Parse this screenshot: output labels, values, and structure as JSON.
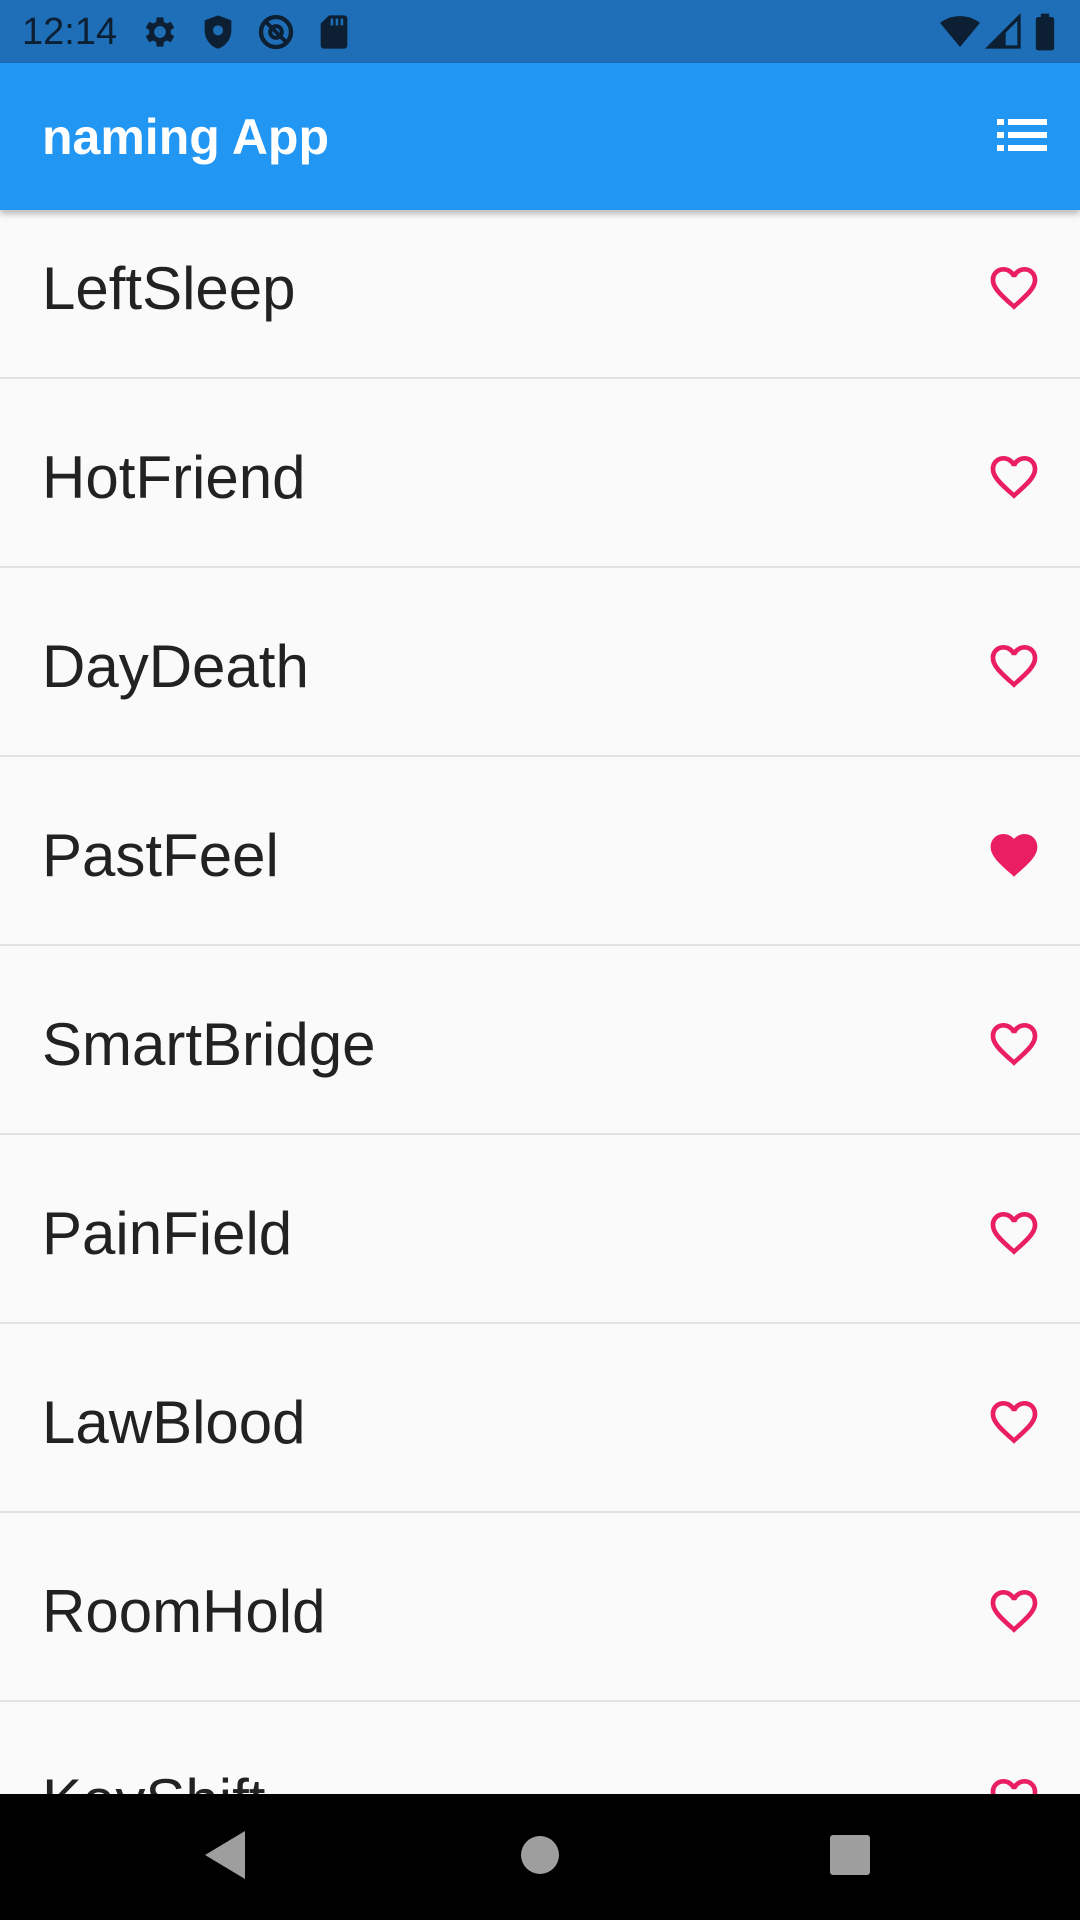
{
  "status_bar": {
    "time": "12:14",
    "icons": [
      "gear-icon",
      "shield-icon",
      "at-sign-icon",
      "sd-card-icon",
      "wifi-icon",
      "signal-icon",
      "battery-icon"
    ]
  },
  "app_bar": {
    "title": "naming App",
    "action_icon": "list-icon"
  },
  "list": {
    "items": [
      {
        "name": "LeftSleep",
        "favorited": false
      },
      {
        "name": "HotFriend",
        "favorited": false
      },
      {
        "name": "DayDeath",
        "favorited": false
      },
      {
        "name": "PastFeel",
        "favorited": true
      },
      {
        "name": "SmartBridge",
        "favorited": false
      },
      {
        "name": "PainField",
        "favorited": false
      },
      {
        "name": "LawBlood",
        "favorited": false
      },
      {
        "name": "RoomHold",
        "favorited": false
      },
      {
        "name": "KeyShift",
        "favorited": false
      }
    ]
  },
  "colors": {
    "status_bar": "#1e6fb8",
    "app_bar": "#2196f3",
    "heart": "#e91e63",
    "background": "#fafafa",
    "divider": "#e2e2e2"
  },
  "nav_bar": {
    "buttons": [
      "back-icon",
      "home-icon",
      "recents-icon"
    ]
  }
}
